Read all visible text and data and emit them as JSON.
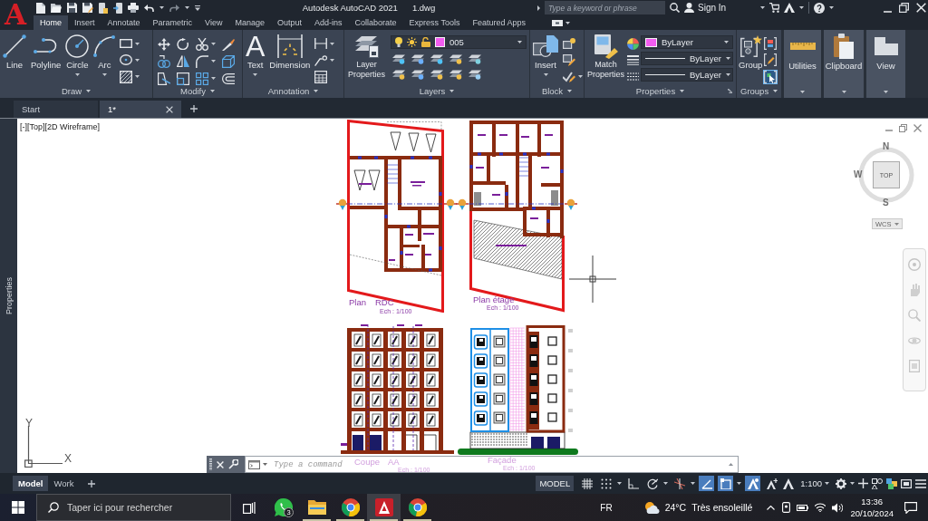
{
  "app": {
    "logo": "A",
    "title": "Autodesk AutoCAD 2021",
    "file": "1.dwg"
  },
  "search": {
    "placeholder": "Type a keyword or phrase"
  },
  "account": {
    "label": "Sign In"
  },
  "ribbon_tabs": [
    {
      "label": "Home",
      "selected": true
    },
    {
      "label": "Insert",
      "selected": false
    },
    {
      "label": "Annotate",
      "selected": false
    },
    {
      "label": "Parametric",
      "selected": false
    },
    {
      "label": "View",
      "selected": false
    },
    {
      "label": "Manage",
      "selected": false
    },
    {
      "label": "Output",
      "selected": false
    },
    {
      "label": "Add-ins",
      "selected": false
    },
    {
      "label": "Collaborate",
      "selected": false
    },
    {
      "label": "Express Tools",
      "selected": false
    },
    {
      "label": "Featured Apps",
      "selected": false
    }
  ],
  "ribbon_panels": [
    {
      "kind": "draw",
      "title": "Draw",
      "tools": [
        {
          "label": "Line",
          "dropdown": false
        },
        {
          "label": "Polyline",
          "dropdown": false
        },
        {
          "label": "Circle",
          "dropdown": true
        },
        {
          "label": "Arc",
          "dropdown": true
        }
      ]
    },
    {
      "kind": "modify",
      "title": "Modify"
    },
    {
      "kind": "annotation",
      "title": "Annotation",
      "tools": [
        {
          "label": "Text",
          "glyph": "A",
          "dropdown": true
        },
        {
          "label": "Dimension",
          "dropdown": false
        }
      ]
    },
    {
      "kind": "layers",
      "title": "Layers",
      "tools": [
        {
          "label": "Layer Properties",
          "dropdown": false
        }
      ],
      "layer": "005"
    },
    {
      "kind": "block",
      "title": "Block",
      "tools": [
        {
          "label": "Insert",
          "dropdown": true
        }
      ]
    },
    {
      "kind": "properties",
      "title": "Properties",
      "tools": [
        {
          "label": "Match Properties",
          "dropdown": false
        }
      ],
      "combos": [
        {
          "kind": "color",
          "value": "ByLayer"
        },
        {
          "kind": "linetype",
          "value": "ByLayer"
        },
        {
          "kind": "lineweight",
          "value": "ByLayer"
        }
      ]
    },
    {
      "kind": "groups",
      "title": "Groups",
      "tools": [
        {
          "label": "Group",
          "dropdown": false
        }
      ],
      "selection_on": true
    },
    {
      "kind": "utilities",
      "title": "Utilities",
      "collapsed": true
    },
    {
      "kind": "clipboard",
      "title": "Clipboard",
      "collapsed": true
    },
    {
      "kind": "view",
      "title": "View",
      "collapsed": true
    }
  ],
  "file_tabs": [
    {
      "label": "Start",
      "selected": false,
      "closable": false
    },
    {
      "label": "1*",
      "selected": true,
      "closable": true
    }
  ],
  "viewport": {
    "controls": "[-][Top][2D Wireframe]",
    "palette": "Properties",
    "viewcube": {
      "north": "N",
      "west": "W",
      "south": "S",
      "face": "TOP",
      "ucs": "WCS"
    },
    "ucs_icon": {
      "y": "Y",
      "x": "X"
    }
  },
  "drawing": {
    "views": [
      {
        "kind": "ground-plan",
        "title": [
          "Plan",
          "RDC"
        ],
        "scale": "Ech : 1/100"
      },
      {
        "kind": "upper-plan",
        "title": [
          "Plan étage"
        ],
        "scale": "Ech : 1/100"
      },
      {
        "kind": "section",
        "title": [
          "Coupe",
          "AA"
        ],
        "scale": "Ech : 1/100"
      },
      {
        "kind": "facade",
        "title": [
          "Façade"
        ],
        "scale": "Ech : 1/100"
      }
    ]
  },
  "command_line": {
    "placeholder": "Type a command"
  },
  "layout_tabs": [
    {
      "label": "Model",
      "selected": true
    },
    {
      "label": "Work",
      "selected": false
    }
  ],
  "status_bar": {
    "space": "MODEL",
    "toggles": [
      {
        "kind": "grid",
        "on": false,
        "dropdown": false
      },
      {
        "kind": "snap",
        "on": false,
        "dropdown": true
      },
      {
        "kind": "ortho",
        "on": false,
        "dropdown": false
      },
      {
        "kind": "polar",
        "on": false,
        "dropdown": true
      },
      {
        "kind": "isodraft",
        "on": false,
        "dropdown": true
      },
      {
        "kind": "tracking",
        "on": true,
        "dropdown": false
      },
      {
        "kind": "osnap",
        "on": true,
        "dropdown": true
      },
      {
        "kind": "annotation-visibility",
        "on": true,
        "dropdown": false
      },
      {
        "kind": "autoscale",
        "on": false,
        "dropdown": false
      }
    ],
    "scale": "1:100"
  },
  "taskbar": {
    "search": {
      "placeholder": "Taper ici pour rechercher"
    },
    "apps": [
      {
        "kind": "whatsapp",
        "badge": "3",
        "running": false,
        "selected": false
      },
      {
        "kind": "explorer",
        "running": true,
        "selected": false
      },
      {
        "kind": "chrome",
        "running": true,
        "selected": false
      },
      {
        "kind": "autocad",
        "running": true,
        "selected": true
      },
      {
        "kind": "chrome",
        "running": true,
        "selected": false
      }
    ],
    "language": "FR",
    "weather": {
      "temperature": "24°C",
      "condition": "Très ensoleillé"
    },
    "time": "13:36",
    "date": "20/10/2024"
  }
}
